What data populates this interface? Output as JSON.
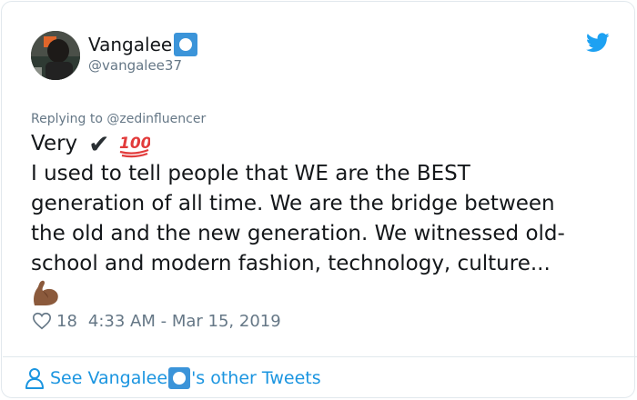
{
  "user": {
    "display_name": "Vangalee",
    "handle": "@vangalee37",
    "badge_icon": "square-ring-emoji-icon",
    "avatar_icon": "profile-photo"
  },
  "brand": {
    "logo_icon": "twitter-bird-icon",
    "accent": "#1da1f2",
    "link_color": "#1b95e0",
    "muted": "#657786"
  },
  "tweet": {
    "replying_to": "Replying to @zedinfluencer",
    "first_word": "Very",
    "check_glyph": "✔",
    "hundred_icon": "hundred-points-emoji-icon",
    "lines": [
      "I used to tell people that WE are the BEST",
      "generation of all time. We are the bridge between",
      "the old and the new generation. We witnessed old-",
      "school and modern fashion, technology, culture..."
    ],
    "trailing_icon": "flexed-biceps-emoji-icon"
  },
  "meta": {
    "like_icon": "heart-outline-icon",
    "likes": "18",
    "timestamp": "4:33 AM - Mar 15, 2019"
  },
  "footer": {
    "link_prefix": "See Vangalee",
    "link_suffix": "'s other Tweets",
    "icon": "person-outline-icon"
  }
}
